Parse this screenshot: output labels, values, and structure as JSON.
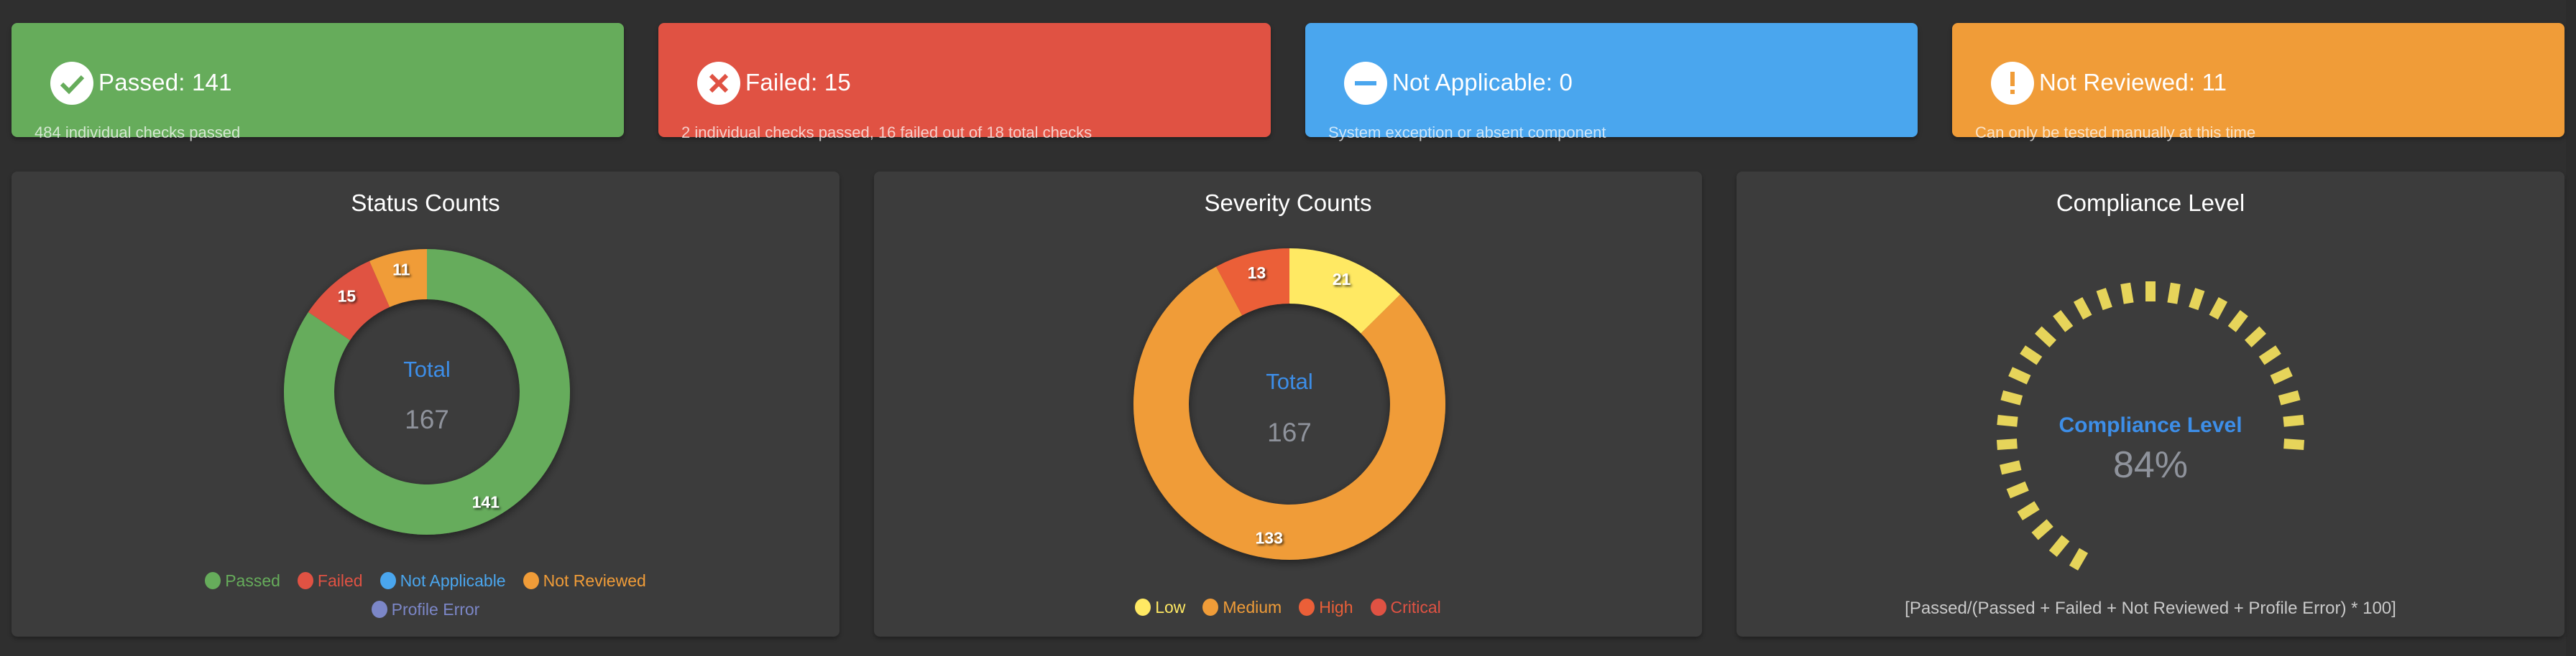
{
  "cards": [
    {
      "id": "passed",
      "title": "Passed: 141",
      "subtitle": "484 individual checks passed",
      "icon": "check-circle-icon",
      "color": "#66ac5b"
    },
    {
      "id": "failed",
      "title": "Failed: 15",
      "subtitle": "2 individual checks passed, 16 failed out of 18 total checks",
      "icon": "x-circle-icon",
      "color": "#e05243"
    },
    {
      "id": "not-applicable",
      "title": "Not Applicable: 0",
      "subtitle": "System exception or absent component",
      "icon": "minus-circle-icon",
      "color": "#4aa6ee"
    },
    {
      "id": "not-reviewed",
      "title": "Not Reviewed: 11",
      "subtitle": "Can only be tested manually at this time",
      "icon": "exclamation-circle-icon",
      "color": "#f09c38"
    }
  ],
  "panels": {
    "status": {
      "title": "Status Counts",
      "center_label": "Total",
      "center_value": "167"
    },
    "severity": {
      "title": "Severity Counts",
      "center_label": "Total",
      "center_value": "167"
    },
    "compliance": {
      "title": "Compliance Level",
      "center_label": "Compliance Level",
      "center_value": "84%",
      "formula": "[Passed/(Passed + Failed + Not Reviewed + Profile Error) * 100]"
    }
  },
  "chart_data": [
    {
      "type": "pie",
      "variant": "donut",
      "title": "Status Counts",
      "center_text": [
        "Total",
        "167"
      ],
      "total": 167,
      "categories": [
        "Passed",
        "Failed",
        "Not Applicable",
        "Not Reviewed",
        "Profile Error"
      ],
      "values": [
        141,
        15,
        0,
        11,
        0
      ],
      "colors": [
        "#66ac5b",
        "#e05243",
        "#4aa6ee",
        "#f09c38",
        "#7c87c8"
      ],
      "legend_position": "bottom"
    },
    {
      "type": "pie",
      "variant": "donut",
      "title": "Severity Counts",
      "center_text": [
        "Total",
        "167"
      ],
      "total": 167,
      "categories": [
        "Low",
        "Medium",
        "High",
        "Critical"
      ],
      "values": [
        21,
        133,
        13,
        0
      ],
      "colors": [
        "#ffe963",
        "#f09c38",
        "#eb5f38",
        "#e05243"
      ],
      "legend_position": "bottom"
    },
    {
      "type": "gauge",
      "title": "Compliance Level",
      "label": "Compliance Level",
      "value": 84,
      "unit": "%",
      "range": [
        0,
        100
      ],
      "color": "#e6d45a"
    }
  ]
}
